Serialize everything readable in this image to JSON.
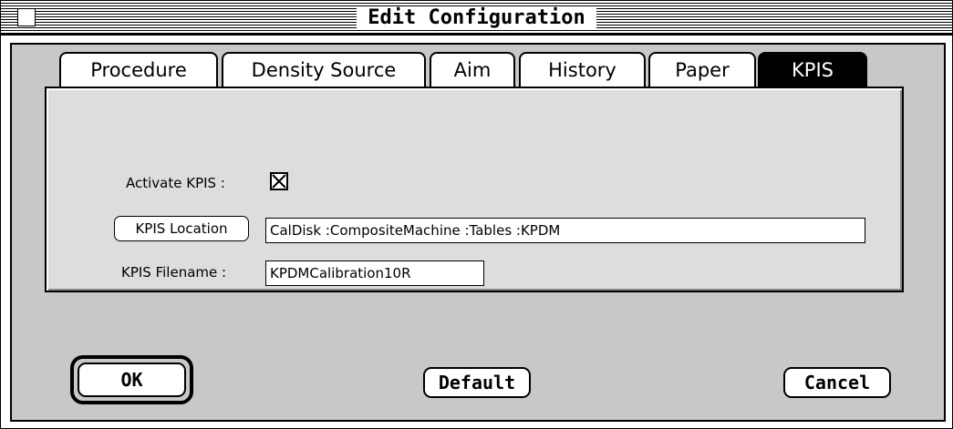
{
  "window": {
    "title": "Edit Configuration"
  },
  "tabs": [
    {
      "label": "Procedure",
      "active": false
    },
    {
      "label": "Density Source",
      "active": false
    },
    {
      "label": "Aim",
      "active": false
    },
    {
      "label": "History",
      "active": false
    },
    {
      "label": "Paper",
      "active": false
    },
    {
      "label": "KPIS",
      "active": true
    }
  ],
  "kpis": {
    "activate_label": "Activate KPIS :",
    "activate_checked": true,
    "location_button": "KPIS Location",
    "location_value": "CalDisk :CompositeMachine :Tables :KPDM",
    "filename_label": "KPIS Filename :",
    "filename_value": "KPDMCalibration10R"
  },
  "buttons": {
    "ok": "OK",
    "default": "Default",
    "cancel": "Cancel"
  },
  "icons": {
    "close_box": "close-box-icon",
    "checkbox": "checkbox-checked-icon"
  }
}
